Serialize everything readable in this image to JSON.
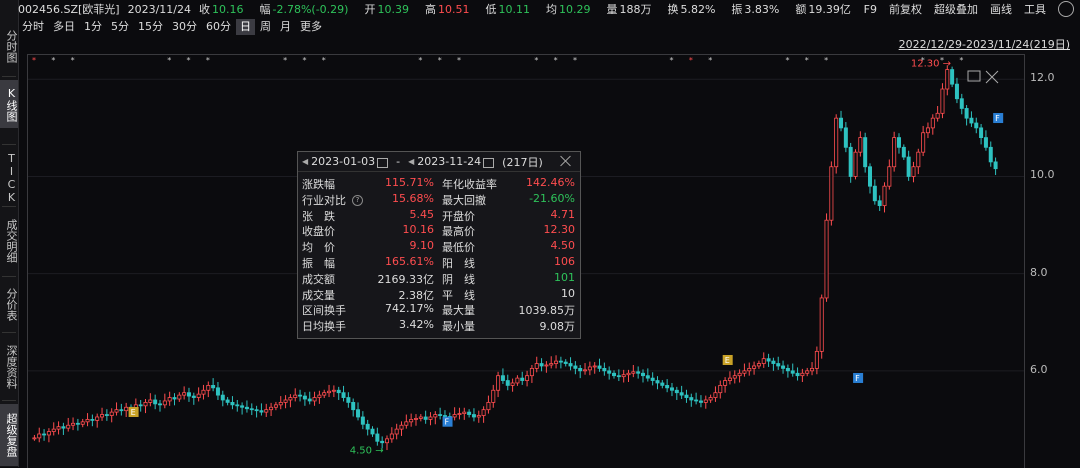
{
  "header": {
    "code": "002456.SZ[欧菲光]",
    "date": "2023/11/24",
    "close_label": "收",
    "close": "10.16",
    "change_label": "幅",
    "change": "-2.78%(-0.29)",
    "open_label": "开",
    "open": "10.39",
    "high_label": "高",
    "high": "10.51",
    "low_label": "低",
    "low": "10.11",
    "avg_label": "均",
    "avg": "10.29",
    "vol_label": "量",
    "vol": "188万",
    "turn_label": "换",
    "turn": "5.82%",
    "amp_label": "振",
    "amp": "3.83%",
    "amt_label": "额",
    "amt": "19.39亿"
  },
  "menu": {
    "f9": "F9",
    "fq": "前复权",
    "overlay": "超级叠加",
    "draw": "画线",
    "tools": "工具"
  },
  "left_tabs": [
    "分时图",
    "K线图",
    "TICK",
    "成交明细",
    "分价表",
    "深度资料",
    "超级复盘"
  ],
  "periods": [
    "分时",
    "多日",
    "1分",
    "5分",
    "15分",
    "30分",
    "60分",
    "日",
    "周",
    "月",
    "更多"
  ],
  "range": "2022/12/29-2023/11/24(219日)",
  "stats": {
    "start": "2023-01-03",
    "end": "2023-11-24",
    "dash": "-",
    "days": "(217日)",
    "rows": [
      {
        "l1": "涨跌幅",
        "v1": "115.71%",
        "l2": "年化收益率",
        "v2": "142.46%"
      },
      {
        "l1": "行业对比",
        "v1": "15.68%",
        "l2": "最大回撤",
        "v2": "-21.60%"
      },
      {
        "l1": "张　跌",
        "v1": "5.45",
        "l2": "开盘价",
        "v2": "4.71"
      },
      {
        "l1": "收盘价",
        "v1": "10.16",
        "l2": "最高价",
        "v2": "12.30"
      },
      {
        "l1": "均　价",
        "v1": "9.10",
        "l2": "最低价",
        "v2": "4.50"
      },
      {
        "l1": "振　幅",
        "v1": "165.61%",
        "l2": "阳　线",
        "v2": "106"
      },
      {
        "l1": "成交额",
        "v1": "2169.33亿",
        "l2": "阴　线",
        "v2": "101"
      },
      {
        "l1": "成交量",
        "v1": "2.38亿",
        "l2": "平　线",
        "v2": "10"
      },
      {
        "l1": "区间换手",
        "v1": "742.17%",
        "l2": "最大量",
        "v2": "1039.85万"
      },
      {
        "l1": "日均换手",
        "v1": "3.42%",
        "l2": "最小量",
        "v2": "9.08万"
      }
    ]
  },
  "colors": {
    "up": "#ff4d4f",
    "down": "#2ec2c0",
    "stat_red": "#ff4d4f",
    "stat_green": "#2ec25a",
    "stat_white": "#dddddd"
  },
  "chart_data": {
    "type": "candlestick",
    "ylim": [
      4.0,
      12.5
    ],
    "yticks": [
      "12.0",
      "10.0",
      "8.0",
      "6.0"
    ],
    "max_label": "12.30",
    "min_label": "4.50",
    "marker_letter": "F",
    "marker_letter_e": "E",
    "closes": [
      4.62,
      4.7,
      4.68,
      4.75,
      4.8,
      4.85,
      4.82,
      4.88,
      4.92,
      4.9,
      4.95,
      5.0,
      4.98,
      5.05,
      5.1,
      5.08,
      5.15,
      5.2,
      5.18,
      5.25,
      5.22,
      5.3,
      5.28,
      5.35,
      5.4,
      5.32,
      5.3,
      5.38,
      5.45,
      5.42,
      5.5,
      5.55,
      5.48,
      5.45,
      5.52,
      5.6,
      5.7,
      5.65,
      5.5,
      5.4,
      5.35,
      5.3,
      5.28,
      5.25,
      5.22,
      5.2,
      5.18,
      5.15,
      5.2,
      5.25,
      5.3,
      5.35,
      5.4,
      5.45,
      5.5,
      5.48,
      5.42,
      5.38,
      5.45,
      5.5,
      5.55,
      5.58,
      5.6,
      5.55,
      5.45,
      5.35,
      5.2,
      5.05,
      4.9,
      4.8,
      4.7,
      4.55,
      4.52,
      4.6,
      4.7,
      4.8,
      4.88,
      4.95,
      5.0,
      5.02,
      5.05,
      5.0,
      5.05,
      5.1,
      5.08,
      5.06,
      5.05,
      5.1,
      5.12,
      5.15,
      5.1,
      5.05,
      5.08,
      5.2,
      5.35,
      5.6,
      5.9,
      5.8,
      5.7,
      5.75,
      5.85,
      5.8,
      5.9,
      6.05,
      6.15,
      6.1,
      6.12,
      6.15,
      6.2,
      6.18,
      6.15,
      6.1,
      6.05,
      6.0,
      6.02,
      6.08,
      6.1,
      6.05,
      6.0,
      5.95,
      5.9,
      5.88,
      5.92,
      5.95,
      5.98,
      5.95,
      5.9,
      5.85,
      5.8,
      5.75,
      5.7,
      5.65,
      5.6,
      5.55,
      5.5,
      5.45,
      5.4,
      5.38,
      5.35,
      5.4,
      5.45,
      5.55,
      5.7,
      5.8,
      5.85,
      5.9,
      5.95,
      6.0,
      6.05,
      6.1,
      6.15,
      6.25,
      6.2,
      6.15,
      6.1,
      6.05,
      6.0,
      5.95,
      5.9,
      5.95,
      6.0,
      6.05,
      6.4,
      7.5,
      9.1,
      10.2,
      11.2,
      11.0,
      10.6,
      10.0,
      10.5,
      10.8,
      10.2,
      9.8,
      9.5,
      9.4,
      9.8,
      10.2,
      10.8,
      10.6,
      10.4,
      10.0,
      10.2,
      10.5,
      10.9,
      11.0,
      11.2,
      11.3,
      11.8,
      12.2,
      11.9,
      11.6,
      11.4,
      11.2,
      11.1,
      11.0,
      10.8,
      10.6,
      10.3,
      10.16
    ]
  }
}
